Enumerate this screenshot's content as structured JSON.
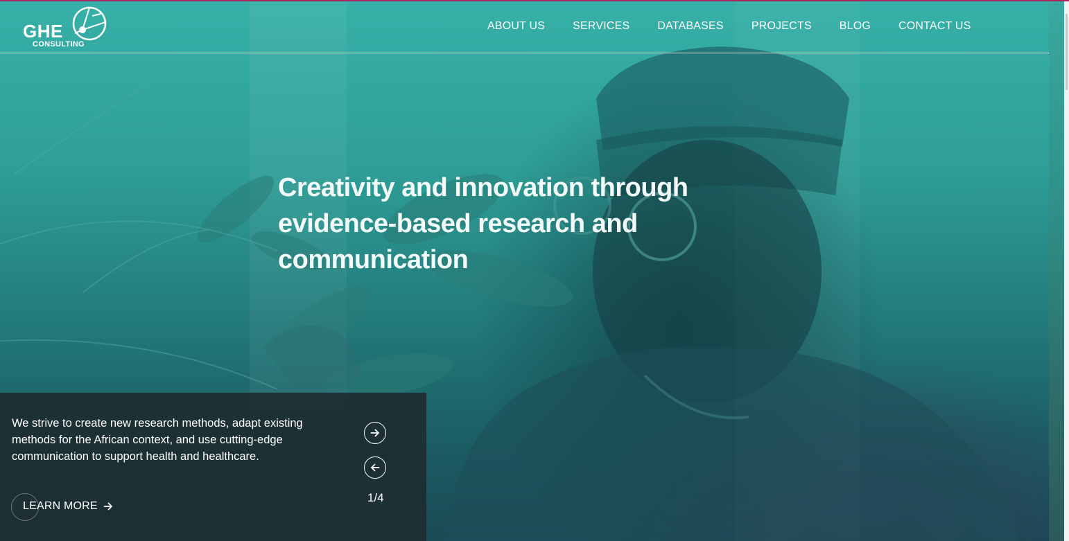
{
  "brand": {
    "name": "GHE",
    "subtitle": "CONSULTING"
  },
  "nav": {
    "items": [
      "ABOUT US",
      "SERVICES",
      "DATABASES",
      "PROJECTS",
      "BLOG",
      "CONTACT US"
    ]
  },
  "hero": {
    "headline_lines": [
      "Creativity and innovation through",
      "evidence-based research and",
      "communication"
    ]
  },
  "panel": {
    "description": "We strive to create new research methods, adapt existing methods for the African context, and use cutting-edge communication to support health and healthcare.",
    "learn_more": "LEARN MORE",
    "counter": "1/4"
  },
  "icons": {
    "logo": "logo-globe-icon",
    "next": "arrow-right-circle-icon",
    "prev": "arrow-left-circle-icon",
    "learn_more": "arrow-right-icon"
  },
  "colors": {
    "accent_top": "#b0245e",
    "hero_teal": "#36b0a8",
    "panel": "#1d2d30",
    "text": "#ffffff"
  }
}
